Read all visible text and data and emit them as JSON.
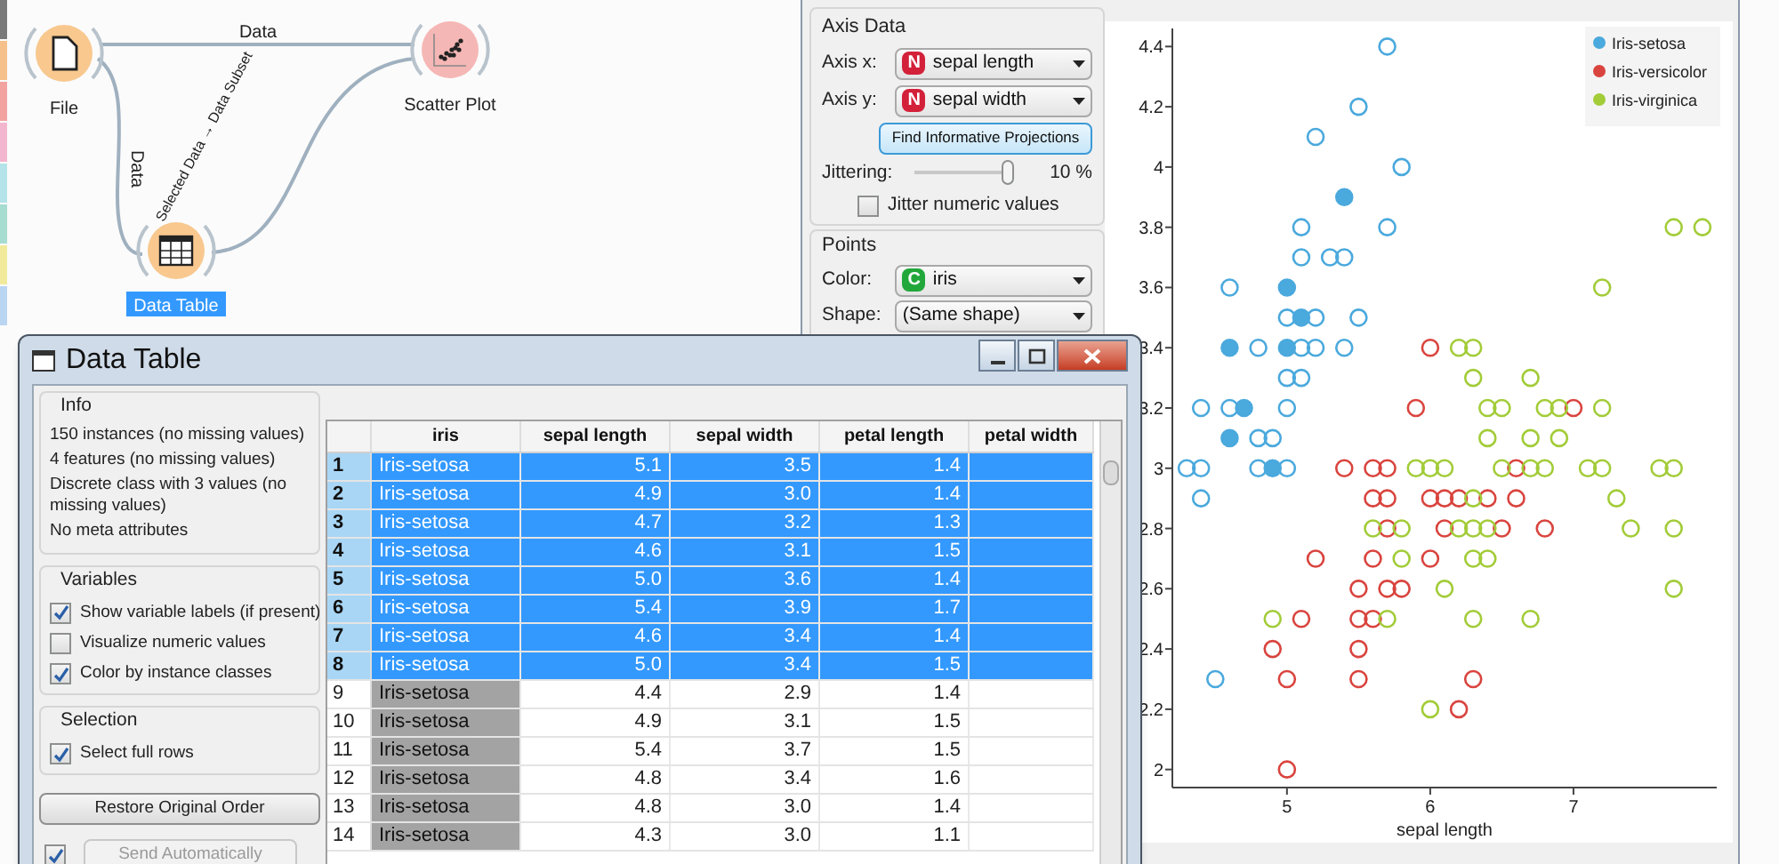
{
  "workflow": {
    "nodes": [
      {
        "label": "File",
        "kind": "file",
        "selected": false
      },
      {
        "label": "Scatter Plot",
        "kind": "scatter",
        "selected": false
      },
      {
        "label": "Data Table",
        "kind": "table",
        "selected": true
      }
    ],
    "links": [
      {
        "label": "Data"
      },
      {
        "label": "Data"
      },
      {
        "label": "Selected Data → Data Subset"
      }
    ]
  },
  "scatter_plot": {
    "axis_data": {
      "title": "Axis Data",
      "axes": [
        {
          "label": "Axis x:",
          "badge": "N",
          "kind": "numeric",
          "value": "sepal length"
        },
        {
          "label": "Axis y:",
          "badge": "N",
          "kind": "numeric",
          "value": "sepal width"
        }
      ],
      "find_button": "Find Informative Projections",
      "jittering": {
        "label": "Jittering:",
        "level": 1.0,
        "reading": "10 %"
      },
      "jitter_numeric": {
        "label": "Jitter numeric values",
        "checked": false
      }
    },
    "points": {
      "title": "Points",
      "color": {
        "label": "Color:",
        "badge": "C",
        "kind": "categorical",
        "value": "iris"
      },
      "shape": {
        "label": "Shape:",
        "value": "(Same shape)"
      }
    },
    "chart_data": {
      "type": "scatter",
      "legend": true,
      "xlabel": "sepal length",
      "xlim": [
        4.2,
        8.0
      ],
      "ylim": [
        1.94,
        4.46
      ],
      "xticks": [
        5,
        6,
        7
      ],
      "yticks": [
        2,
        2.2,
        2.4,
        2.6,
        2.8,
        3,
        3.2,
        3.4,
        3.6,
        3.8,
        4,
        4.2,
        4.4
      ],
      "series": [
        {
          "name": "Iris-setosa",
          "color": "#4aa9dd",
          "x": [
            5.7,
            5.5,
            5.2,
            5.8,
            5.1,
            5.7,
            5.1,
            5.3,
            5.4,
            4.6,
            5.0,
            5.2,
            5.5,
            4.8,
            5.1,
            5.2,
            5.4,
            5.0,
            5.1,
            4.4,
            4.6,
            5.0,
            4.8,
            4.9,
            4.3,
            4.4,
            4.8,
            5.0,
            4.4,
            4.5,
            5.1,
            4.9,
            4.7,
            4.6,
            5.0,
            5.4,
            4.6,
            5.0
          ],
          "values": [
            4.4,
            4.2,
            4.1,
            4.0,
            3.8,
            3.8,
            3.7,
            3.7,
            3.7,
            3.6,
            3.5,
            3.5,
            3.5,
            3.4,
            3.4,
            3.4,
            3.4,
            3.3,
            3.3,
            3.2,
            3.2,
            3.2,
            3.1,
            3.1,
            3.0,
            3.0,
            3.0,
            3.0,
            2.9,
            2.3,
            3.5,
            3.0,
            3.2,
            3.1,
            3.6,
            3.9,
            3.4,
            3.4
          ]
        },
        {
          "name": "Iris-versicolor",
          "color": "#d9443e",
          "x": [
            6.0,
            5.9,
            7.0,
            5.4,
            5.6,
            5.7,
            6.6,
            5.6,
            5.7,
            6.0,
            6.1,
            6.2,
            6.4,
            6.6,
            5.7,
            6.1,
            6.5,
            6.8,
            5.2,
            5.6,
            6.0,
            5.5,
            5.7,
            5.8,
            5.1,
            5.5,
            5.6,
            4.9,
            5.5,
            5.0,
            5.5,
            6.3,
            6.2,
            5.0
          ],
          "values": [
            3.4,
            3.2,
            3.2,
            3.0,
            3.0,
            3.0,
            3.0,
            2.9,
            2.9,
            2.9,
            2.9,
            2.9,
            2.9,
            2.9,
            2.8,
            2.8,
            2.8,
            2.8,
            2.7,
            2.7,
            2.7,
            2.6,
            2.6,
            2.6,
            2.5,
            2.5,
            2.5,
            2.4,
            2.4,
            2.3,
            2.3,
            2.3,
            2.2,
            2.0
          ]
        },
        {
          "name": "Iris-virginica",
          "color": "#a2cc38",
          "x": [
            7.7,
            7.9,
            7.2,
            6.2,
            6.3,
            6.3,
            6.7,
            6.4,
            6.5,
            6.8,
            6.9,
            7.2,
            6.4,
            6.7,
            6.9,
            5.9,
            6.0,
            6.1,
            6.5,
            6.7,
            6.8,
            7.1,
            7.2,
            7.6,
            7.7,
            6.3,
            7.3,
            5.6,
            5.8,
            6.2,
            6.3,
            6.4,
            7.4,
            7.7,
            5.8,
            6.3,
            6.4,
            6.1,
            7.7,
            4.9,
            5.7,
            6.3,
            6.7,
            6.0
          ],
          "values": [
            3.8,
            3.8,
            3.6,
            3.4,
            3.4,
            3.3,
            3.3,
            3.2,
            3.2,
            3.2,
            3.2,
            3.2,
            3.1,
            3.1,
            3.1,
            3.0,
            3.0,
            3.0,
            3.0,
            3.0,
            3.0,
            3.0,
            3.0,
            3.0,
            3.0,
            2.9,
            2.9,
            2.8,
            2.8,
            2.8,
            2.8,
            2.8,
            2.8,
            2.8,
            2.7,
            2.7,
            2.7,
            2.6,
            2.6,
            2.5,
            2.5,
            2.5,
            2.5,
            2.2
          ]
        }
      ]
    }
  },
  "data_table": {
    "title": "Data Table",
    "info": {
      "title": "Info",
      "lines": [
        "150 instances (no missing values)",
        "4 features (no missing values)",
        "Discrete class with 3 values (no missing values)",
        "No meta attributes"
      ]
    },
    "variables": {
      "title": "Variables",
      "options": [
        {
          "label": "Show variable labels (if present)",
          "checked": true
        },
        {
          "label": "Visualize numeric values",
          "checked": false
        },
        {
          "label": "Color by instance classes",
          "checked": true
        }
      ]
    },
    "selection": {
      "title": "Selection",
      "options": [
        {
          "label": "Select full rows",
          "checked": true
        }
      ]
    },
    "restore_button": "Restore Original Order",
    "send_automatically": {
      "checked": true,
      "label": "Send Automatically",
      "disabled": true
    },
    "table": {
      "columns": [
        "iris",
        "sepal length",
        "sepal width",
        "petal length",
        "petal width"
      ],
      "rows": [
        {
          "index": "1",
          "selected": true,
          "cells": [
            "Iris-setosa",
            "5.1",
            "3.5",
            "1.4"
          ]
        },
        {
          "index": "2",
          "selected": true,
          "cells": [
            "Iris-setosa",
            "4.9",
            "3.0",
            "1.4"
          ]
        },
        {
          "index": "3",
          "selected": true,
          "cells": [
            "Iris-setosa",
            "4.7",
            "3.2",
            "1.3"
          ]
        },
        {
          "index": "4",
          "selected": true,
          "cells": [
            "Iris-setosa",
            "4.6",
            "3.1",
            "1.5"
          ]
        },
        {
          "index": "5",
          "selected": true,
          "cells": [
            "Iris-setosa",
            "5.0",
            "3.6",
            "1.4"
          ]
        },
        {
          "index": "6",
          "selected": true,
          "cells": [
            "Iris-setosa",
            "5.4",
            "3.9",
            "1.7"
          ]
        },
        {
          "index": "7",
          "selected": true,
          "cells": [
            "Iris-setosa",
            "4.6",
            "3.4",
            "1.4"
          ]
        },
        {
          "index": "8",
          "selected": true,
          "cells": [
            "Iris-setosa",
            "5.0",
            "3.4",
            "1.5"
          ]
        },
        {
          "index": "9",
          "selected": false,
          "cells": [
            "Iris-setosa",
            "4.4",
            "2.9",
            "1.4"
          ]
        },
        {
          "index": "10",
          "selected": false,
          "cells": [
            "Iris-setosa",
            "4.9",
            "3.1",
            "1.5"
          ]
        },
        {
          "index": "11",
          "selected": false,
          "cells": [
            "Iris-setosa",
            "5.4",
            "3.7",
            "1.5"
          ]
        },
        {
          "index": "12",
          "selected": false,
          "cells": [
            "Iris-setosa",
            "4.8",
            "3.4",
            "1.6"
          ]
        },
        {
          "index": "13",
          "selected": false,
          "cells": [
            "Iris-setosa",
            "4.8",
            "3.0",
            "1.4"
          ]
        },
        {
          "index": "14",
          "selected": false,
          "cells": [
            "Iris-setosa",
            "4.3",
            "3.0",
            "1.1"
          ]
        }
      ]
    }
  }
}
